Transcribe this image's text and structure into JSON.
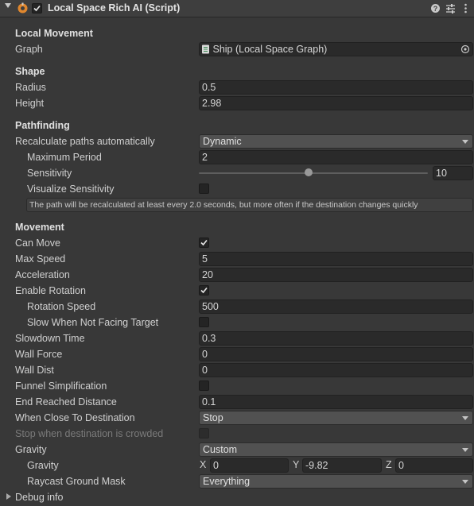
{
  "component": {
    "title": "Local Space Rich AI (Script)",
    "enabled": true,
    "icons": [
      "help-icon",
      "presets-icon",
      "more-icon"
    ]
  },
  "local_movement": {
    "header": "Local Movement",
    "graph_label": "Graph",
    "graph_value": "Ship (Local Space Graph)"
  },
  "shape": {
    "header": "Shape",
    "radius_label": "Radius",
    "radius_value": "0.5",
    "height_label": "Height",
    "height_value": "2.98"
  },
  "pathfinding": {
    "header": "Pathfinding",
    "recalc_label": "Recalculate paths automatically",
    "recalc_value": "Dynamic",
    "max_period_label": "Maximum Period",
    "max_period_value": "2",
    "sensitivity_label": "Sensitivity",
    "sensitivity_value": "10",
    "visualize_label": "Visualize Sensitivity",
    "visualize_checked": false,
    "help_text": "The path will be recalculated at least every 2.0 seconds, but more often if the destination changes quickly"
  },
  "movement": {
    "header": "Movement",
    "can_move_label": "Can Move",
    "can_move_checked": true,
    "max_speed_label": "Max Speed",
    "max_speed_value": "5",
    "acceleration_label": "Acceleration",
    "acceleration_value": "20",
    "enable_rotation_label": "Enable Rotation",
    "enable_rotation_checked": true,
    "rotation_speed_label": "Rotation Speed",
    "rotation_speed_value": "500",
    "slow_not_facing_label": "Slow When Not Facing Target",
    "slow_not_facing_checked": false,
    "slowdown_label": "Slowdown Time",
    "slowdown_value": "0.3",
    "wall_force_label": "Wall Force",
    "wall_force_value": "0",
    "wall_dist_label": "Wall Dist",
    "wall_dist_value": "0",
    "funnel_label": "Funnel Simplification",
    "funnel_checked": false,
    "end_reached_label": "End Reached Distance",
    "end_reached_value": "0.1",
    "close_dest_label": "When Close To Destination",
    "close_dest_value": "Stop",
    "crowded_label": "Stop when destination is crowded",
    "crowded_checked": false,
    "gravity_label": "Gravity",
    "gravity_value": "Custom",
    "gravity_vec_label": "Gravity",
    "gx_label": "X",
    "gx_value": "0",
    "gy_label": "Y",
    "gy_value": "-9.82",
    "gz_label": "Z",
    "gz_value": "0",
    "raycast_label": "Raycast Ground Mask",
    "raycast_value": "Everything"
  },
  "debug": {
    "label": "Debug info"
  }
}
